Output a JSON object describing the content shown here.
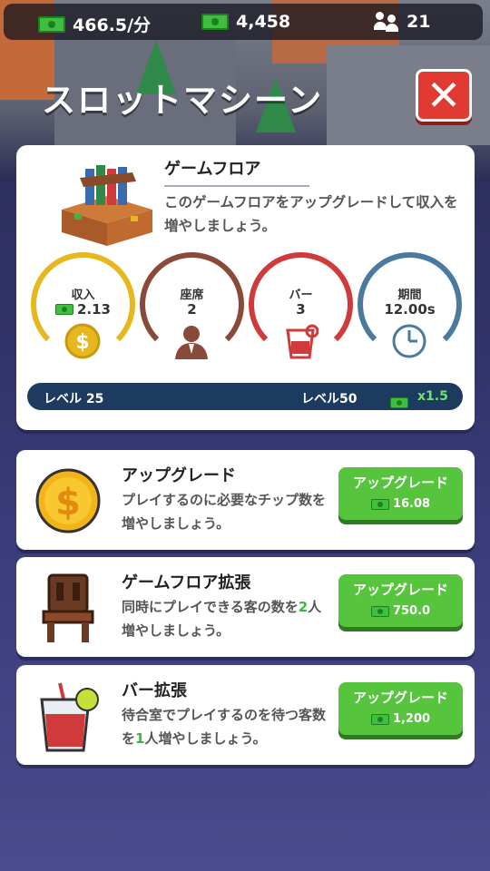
{
  "topbar": {
    "income_rate": "466.5/分",
    "cash": "4,458",
    "visitors": "21"
  },
  "title": "スロットマシーン",
  "close_label": "✕",
  "floor": {
    "title": "ゲームフロア",
    "description": "このゲームフロアをアップグレードして収入を増やしましょう。"
  },
  "stats": [
    {
      "label": "収入",
      "value": "2.13",
      "color": "#e6b81e"
    },
    {
      "label": "座席",
      "value": "2",
      "color": "#8a4a3a"
    },
    {
      "label": "バー",
      "value": "3",
      "color": "#d03a3a"
    },
    {
      "label": "期間",
      "value": "12.00s",
      "color": "#4a7aa0"
    }
  ],
  "level": {
    "current": "レベル 25",
    "target": "レベル50",
    "multiplier": "x1.5"
  },
  "upgrades": [
    {
      "title": "アップグレード",
      "desc_parts": [
        "プレイするのに必要なチップ数を増やしましょう。"
      ],
      "button": "アップグレード",
      "cost": "16.08"
    },
    {
      "title": "ゲームフロア拡張",
      "desc_before": "同時にプレイできる客の数を",
      "desc_num": "2",
      "desc_after": "人増やしましょう。",
      "button": "アップグレード",
      "cost": "750.0"
    },
    {
      "title": "バー拡張",
      "desc_before": "待合室でプレイするのを待つ客数を",
      "desc_num": "1",
      "desc_after": "人増やしましょう。",
      "button": "アップグレード",
      "cost": "1,200"
    }
  ]
}
